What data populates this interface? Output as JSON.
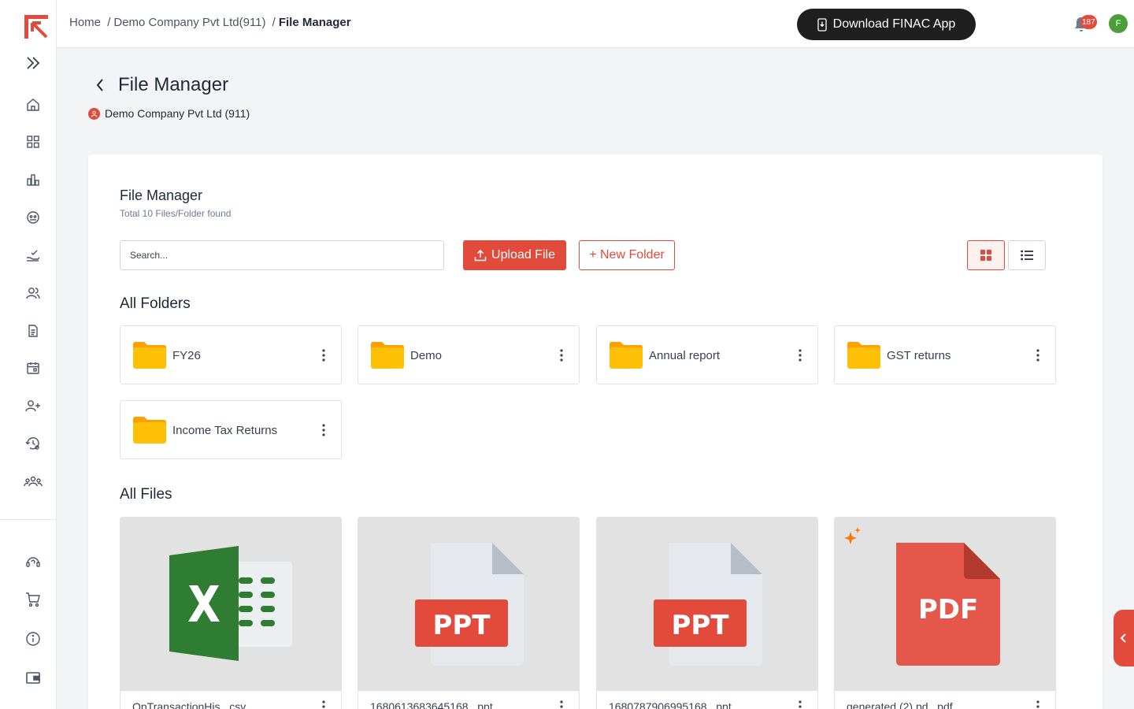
{
  "header": {
    "breadcrumb": {
      "home": "Home",
      "sep1": "/",
      "company": "Demo Company Pvt Ltd(911)",
      "sep2": "/",
      "current": "File Manager"
    },
    "download_label": "Download FINAC App",
    "notification_count": "187",
    "avatar_initial": "F"
  },
  "page": {
    "title": "File Manager",
    "company": "Demo Company Pvt Ltd (911)"
  },
  "card": {
    "title": "File Manager",
    "subtitle": "Total 10 Files/Folder found",
    "search_placeholder": "Search...",
    "upload_label": "Upload File",
    "new_folder_label": "+ New Folder"
  },
  "folders_title": "All Folders",
  "folders": [
    {
      "name": "FY26"
    },
    {
      "name": "Demo"
    },
    {
      "name": "Annual report"
    },
    {
      "name": "GST returns"
    },
    {
      "name": "Income Tax Returns"
    }
  ],
  "files_title": "All Files",
  "files": [
    {
      "name": "OpTransactionHis...csv",
      "type": "csv"
    },
    {
      "name": "1680613683645168...ppt",
      "type": "ppt",
      "label": "PPT"
    },
    {
      "name": "1680787906995168...ppt",
      "type": "ppt",
      "label": "PPT"
    },
    {
      "name": "generated (2).pd...pdf",
      "type": "pdf",
      "label": "PDF"
    }
  ],
  "colors": {
    "accent": "#e24a3b",
    "folder": "#ffc107",
    "excel": "#2e7d32",
    "dark": "#1f1f1f"
  }
}
